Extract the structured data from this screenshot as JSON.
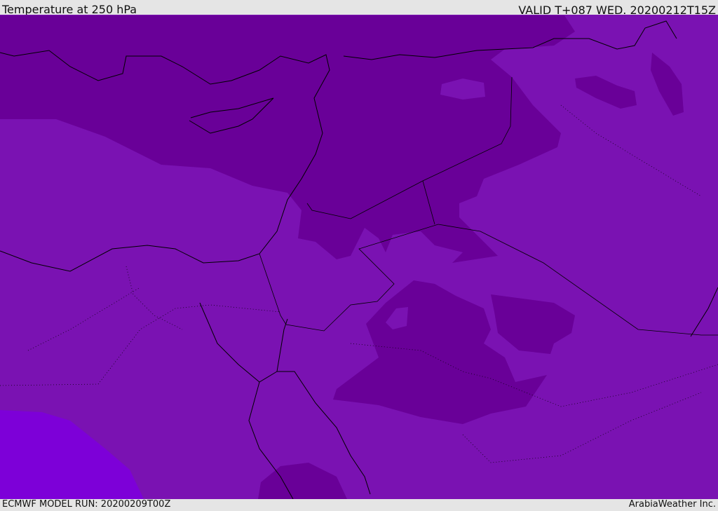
{
  "header": {
    "title": "Temperature at 250 hPa",
    "valid_time": "VALID T+087 WED. 20200212T15Z"
  },
  "footer": {
    "model_run": "ECMWF MODEL RUN: 20200209T00Z",
    "credit": "ArabiaWeather Inc."
  },
  "colors": {
    "base": "#7a12b2",
    "dark": "#690098",
    "bright": "#7d00d8",
    "border": "#000000"
  }
}
